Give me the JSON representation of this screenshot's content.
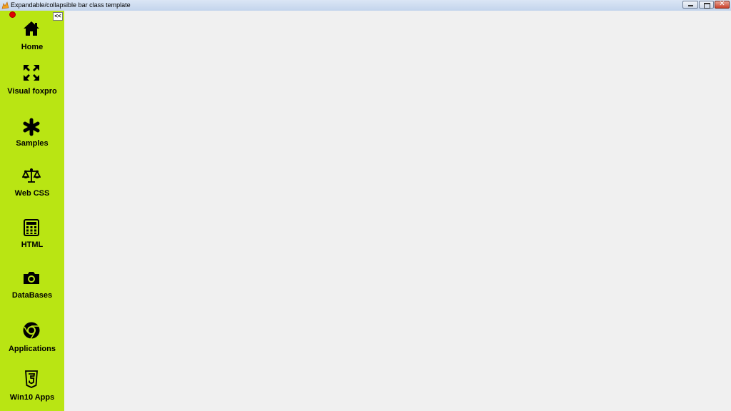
{
  "window": {
    "title": "Expandable/collapsible bar class template",
    "controls": {
      "minimize": "minimize-icon",
      "maximize": "maximize-icon",
      "close": "close-icon"
    }
  },
  "sidebar": {
    "background": "#b9e513",
    "collapse_label": "<<",
    "status_color": "#e00000",
    "items": [
      {
        "label": "Home",
        "icon": "home-icon"
      },
      {
        "label": "Visual foxpro",
        "icon": "expand-arrows-icon"
      },
      {
        "label": "Samples",
        "icon": "asterisk-icon"
      },
      {
        "label": "Web CSS",
        "icon": "balance-scale-icon"
      },
      {
        "label": "HTML",
        "icon": "calculator-icon"
      },
      {
        "label": "DataBases",
        "icon": "camera-icon"
      },
      {
        "label": "Applications",
        "icon": "chrome-icon"
      },
      {
        "label": "Win10 Apps",
        "icon": "html5-icon"
      }
    ]
  }
}
